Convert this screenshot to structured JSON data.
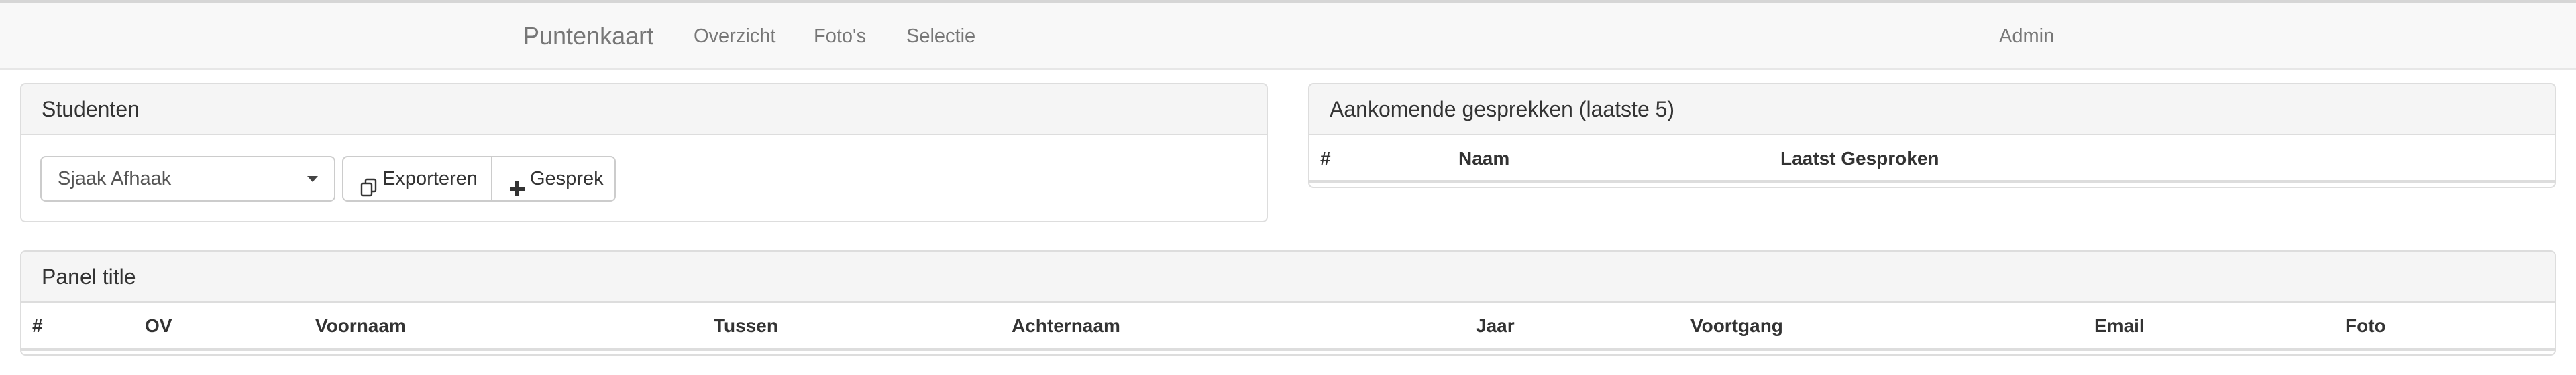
{
  "navbar": {
    "brand": "Puntenkaart",
    "links": [
      "Overzicht",
      "Foto's",
      "Selectie"
    ],
    "user": "Admin"
  },
  "students_panel": {
    "title": "Studenten",
    "selected_student": "Sjaak Afhaak",
    "export_label": "Exporteren",
    "conversation_label": "Gesprek",
    "export_icon": "copy-icon",
    "conversation_icon": "plus-icon"
  },
  "upcoming_panel": {
    "title": "Aankomende gesprekken (laatste 5)",
    "columns": [
      "#",
      "Naam",
      "Laatst Gesproken"
    ]
  },
  "main_panel": {
    "title": "Panel title",
    "columns": [
      "#",
      "OV",
      "Voornaam",
      "Tussen",
      "Achternaam",
      "Jaar",
      "Voortgang",
      "Email",
      "Foto"
    ]
  },
  "colors": {
    "navbar_bg": "#f8f8f8",
    "panel_heading_bg": "#f5f5f5",
    "border": "#dddddd",
    "muted_text": "#777777"
  }
}
